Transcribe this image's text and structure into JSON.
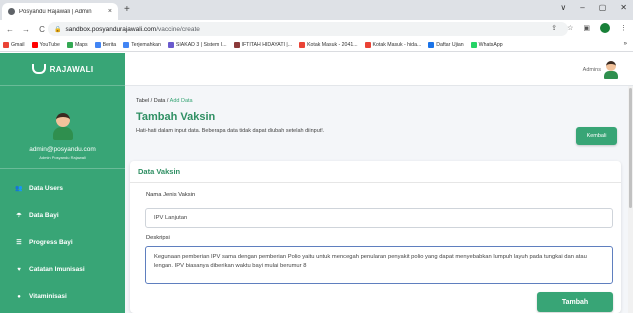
{
  "browser": {
    "tab_title": "Posyandu Rajawali | Admin",
    "tab_close": "×",
    "new_tab": "+",
    "win_controls": [
      "∨",
      "–",
      "▢",
      "✕"
    ],
    "nav": {
      "back": "←",
      "forward": "→",
      "reload": "C"
    },
    "url_host": "sandbox.posyandurajawali.com",
    "url_path": "/vaccine/create",
    "bookmarks": [
      {
        "label": "Gmail",
        "color": "#ea4335"
      },
      {
        "label": "YouTube",
        "color": "#ff0000"
      },
      {
        "label": "Maps",
        "color": "#34a853"
      },
      {
        "label": "Berita",
        "color": "#4285f4"
      },
      {
        "label": "Terjemahkan",
        "color": "#4285f4"
      },
      {
        "label": "SIAKAD 3 | Sistem I...",
        "color": "#6a5acd"
      },
      {
        "label": "IFTITAH HIDAYATI |...",
        "color": "#8b3a3a"
      },
      {
        "label": "Kotak Masuk - 2041...",
        "color": "#ea4335"
      },
      {
        "label": "Kotak Masuk - hida...",
        "color": "#ea4335"
      },
      {
        "label": "Daftar Ujian",
        "color": "#1a73e8"
      },
      {
        "label": "WhatsApp",
        "color": "#25d366"
      }
    ],
    "bookmarks_more": "»"
  },
  "sidebar": {
    "brand": "RAJAWALI",
    "user_name": "admin@posyandu.com",
    "user_role": "Admin Posyandu Rajawali",
    "items": [
      {
        "label": "Data Users",
        "icon": "users-icon",
        "glyph": "👥"
      },
      {
        "label": "Data Bayi",
        "icon": "baby-icon",
        "glyph": "☂"
      },
      {
        "label": "Progress Bayi",
        "icon": "list-icon",
        "glyph": "☰"
      },
      {
        "label": "Catatan Imunisasi",
        "icon": "heart-icon",
        "glyph": "♥"
      },
      {
        "label": "Vitaminisasi",
        "icon": "pills-icon",
        "glyph": "●"
      }
    ]
  },
  "topbar": {
    "admin_label": "Admins"
  },
  "main": {
    "breadcrumb": {
      "part1": "Tabel",
      "sep1": " / ",
      "part2": "Data",
      "sep2": " / ",
      "current": "Add Data"
    },
    "title": "Tambah Vaksin",
    "description": "Hati-hati dalam input data. Beberapa data tidak dapat diubah setelah diinput!.",
    "back_button": "Kembali",
    "card_title": "Data Vaksin",
    "field_name_label": "Nama Jenis Vaksin",
    "field_name_value": "IPV Lanjutan",
    "field_desc_label": "Deskripsi",
    "field_desc_value": "Kegunaan pemberian IPV sama dengan pemberian Polio yaitu untuk mencegah penularan penyakit polio yang dapat menyebabkan lumpuh layuh pada tungkai dan atau lengan. IPV biasanya diberikan waktu bayi mulai berumur 8",
    "submit_button": "Tambah"
  }
}
